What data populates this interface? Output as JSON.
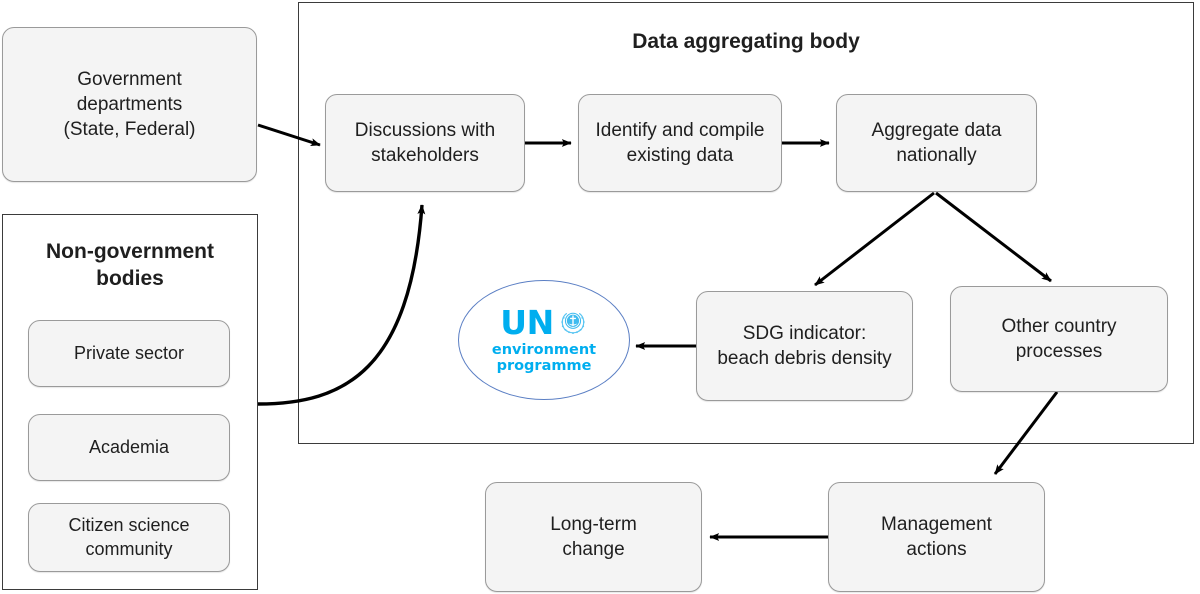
{
  "diagram": {
    "title": "Data aggregating body",
    "container": {
      "label": "Data aggregating body"
    },
    "nongov_group": {
      "title": "Non-government\nbodies"
    },
    "nodes": {
      "government_departments": "Government\ndepartments\n(State, Federal)",
      "private_sector": "Private sector",
      "academia": "Academia",
      "citizen_science": "Citizen science\ncommunity",
      "discussions": "Discussions with\nstakeholders",
      "identify_compile": "Identify and compile\nexisting data",
      "aggregate_nationally": "Aggregate data\nnationally",
      "sdg_indicator": "SDG indicator:\nbeach debris density",
      "other_country": "Other country\nprocesses",
      "management_actions": "Management\nactions",
      "long_term_change": "Long-term\nchange"
    },
    "logo": {
      "wordmark": "UN",
      "tagline": "environment\nprogramme",
      "emblem": "un-emblem-icon",
      "color": "#00AEEF",
      "ring_color": "#5b7fc4"
    },
    "colors": {
      "node_fill": "#f4f4f4",
      "node_stroke": "#9a9a9a",
      "container_stroke": "#3b3b3b",
      "arrow": "#000000",
      "text": "#1f1f1f"
    },
    "arrows": [
      {
        "name": "government-to-discussions",
        "from": "government_departments",
        "to": "discussions"
      },
      {
        "name": "nongov-to-discussions",
        "from": "nongov_group",
        "to": "discussions"
      },
      {
        "name": "discussions-to-identify",
        "from": "discussions",
        "to": "identify_compile"
      },
      {
        "name": "identify-to-aggregate",
        "from": "identify_compile",
        "to": "aggregate_nationally"
      },
      {
        "name": "aggregate-to-sdg",
        "from": "aggregate_nationally",
        "to": "sdg_indicator"
      },
      {
        "name": "aggregate-to-other-country",
        "from": "aggregate_nationally",
        "to": "other_country"
      },
      {
        "name": "sdg-to-logo",
        "from": "sdg_indicator",
        "to": "logo"
      },
      {
        "name": "other-country-to-management",
        "from": "other_country",
        "to": "management_actions"
      },
      {
        "name": "management-to-long-term",
        "from": "management_actions",
        "to": "long_term_change"
      }
    ]
  }
}
